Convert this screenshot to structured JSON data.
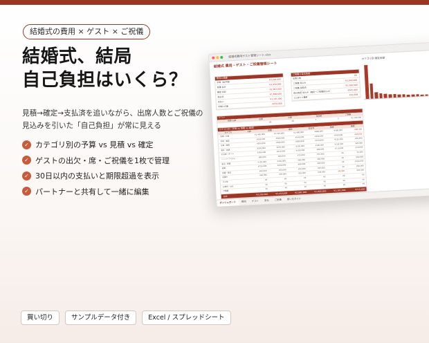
{
  "hero": {
    "category_tag": "結婚式の費用 × ゲスト × ご祝儀",
    "headline_line1": "結婚式、結局",
    "headline_line2": "自己負担はいくら？",
    "description_line1": "見積→確定→支払済を追いながら、出席人数とご祝儀の",
    "description_line2": "見込みを引いた「自己負担」が常に見える",
    "features": [
      "カテゴリ別の予算 vs 見積 vs 確定",
      "ゲストの出欠・席・ご祝儀を1枚で管理",
      "30日以内の支払いと期限超過を表示",
      "パートナーと共有して一緒に編集"
    ]
  },
  "bottom_tags": [
    "買い切り",
    "サンプルデータ付き",
    "Excel / スプレッドシート"
  ],
  "spreadsheet": {
    "window_title": "結婚式費用ゲスト管理シート.xlsx",
    "sheet_title": "結婚式 費用・ゲスト・ご祝儀管理シート",
    "summary_header": "費用の概要",
    "summary_rows": [
      {
        "label": "予算（総予算）",
        "value": "¥3,200,000"
      },
      {
        "label": "見積 合計",
        "value": "¥3,450,000"
      },
      {
        "label": "確定 合計",
        "value": "¥2,981,000"
      },
      {
        "label": "支払済",
        "value": "¥1,800,000"
      },
      {
        "label": "未払い",
        "value": "¥1,181,000"
      },
      {
        "label": "予算との差",
        "value": "-¥250,000"
      }
    ],
    "burden_header": "ご祝儀と自己負担",
    "burden_rows": [
      {
        "label": "出席人数",
        "value": "68"
      },
      {
        "label": "ご祝儀 見込み",
        "value": "¥2,040,000"
      },
      {
        "label": "ご祝儀 受取済",
        "value": "¥1,560,000"
      },
      {
        "label": "自己負担 見込み（確定－ご祝儀見込み）",
        "value": "¥941,000"
      },
      {
        "label": "1人あたり費用",
        "value": "¥43,838"
      }
    ],
    "chart_title": "カテゴリ別 確定金額",
    "chart_bars": [
      0.95,
      0.42,
      0.18,
      0.14,
      0.12,
      0.1,
      0.09,
      0.08,
      0.07,
      0.06,
      0.05,
      0.05,
      0.04,
      0.04,
      0.03,
      0.03
    ],
    "guest_header": "ゲスト",
    "guest_cols": [
      "招待 人数",
      "出席",
      "欠席",
      "未回答",
      "ご祝儀"
    ],
    "guest_values": [
      "80",
      "68",
      "7",
      "5",
      "¥1,560,000"
    ],
    "table_header": "カテゴリ別（予算 vs 見積 vs 確定）",
    "table_cols": [
      "カテゴリ",
      "予算",
      "見積",
      "確定",
      "支払済",
      "残金",
      "差額"
    ],
    "table_rows": [
      [
        "会場・料理",
        "¥1,400,000",
        "¥1,520,000",
        "¥1,480,000",
        "¥900,000",
        "¥580,000",
        "-¥80,000"
      ],
      [
        "衣装・美容",
        "¥500,000",
        "¥560,000",
        "¥540,000",
        "¥300,000",
        "¥240,000",
        "-¥40,000"
      ],
      [
        "写真・映像",
        "¥300,000",
        "¥320,000",
        "¥280,000",
        "¥150,000",
        "¥130,000",
        "¥20,000"
      ],
      [
        "装花・装飾",
        "¥250,000",
        "¥270,000",
        "¥230,000",
        "¥100,000",
        "¥130,000",
        "¥20,000"
      ],
      [
        "引出物・ギフト",
        "¥200,000",
        "¥210,000",
        "¥190,000",
        "¥80,000",
        "¥110,000",
        "¥10,000"
      ],
      [
        "ペーパーアイテム",
        "¥80,000",
        "¥90,000",
        "¥75,000",
        "¥75,000",
        "¥0",
        "¥5,000"
      ],
      [
        "演出・音響",
        "¥120,000",
        "¥140,000",
        "¥60,000",
        "¥60,000",
        "¥0",
        "¥60,000"
      ],
      [
        "指輪",
        "¥250,000",
        "¥260,000",
        "¥86,000",
        "¥86,000",
        "¥0",
        "¥164,000"
      ],
      [
        "交通・宿泊",
        "¥60,000",
        "¥50,000",
        "¥20,000",
        "¥20,000",
        "¥0",
        "¥40,000"
      ],
      [
        "前撮り",
        "¥40,000",
        "¥30,000",
        "¥20,000",
        "¥29,000",
        "-¥9,000",
        "¥20,000"
      ],
      [
        "その他",
        "¥0",
        "¥0",
        "¥0",
        "¥0",
        "¥0",
        "¥0"
      ],
      [
        "お車代・お礼",
        "¥0",
        "¥0",
        "¥0",
        "¥0",
        "¥0",
        "¥0"
      ],
      [
        "予備費",
        "¥0",
        "¥0",
        "¥0",
        "¥0",
        "¥0",
        "¥0"
      ]
    ],
    "table_total": [
      "合計",
      "¥3,200,000",
      "¥3,450,000",
      "¥2,981,000",
      "¥1,800,000",
      "¥1,181,000",
      "¥219,000"
    ],
    "tabs": [
      "ダッシュボード",
      "費用",
      "ゲスト",
      "支払",
      "ご祝儀",
      "使い方ガイド"
    ],
    "colors": {
      "accent": "#9c3524",
      "accent_light": "#c65b3d",
      "negative": "#c0392b"
    }
  }
}
